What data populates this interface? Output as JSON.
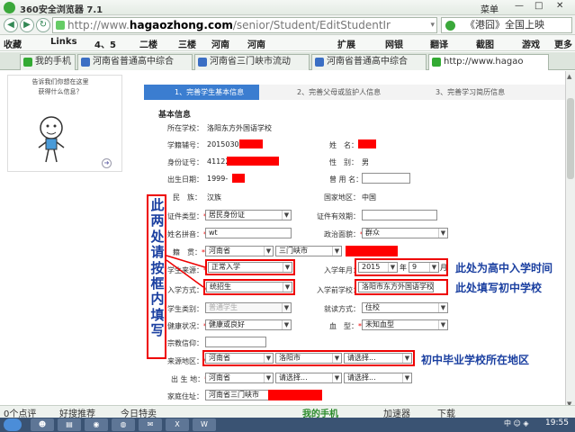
{
  "browser": {
    "title": "360安全浏览器 7.1",
    "menu_label": "菜单",
    "url": {
      "scheme": "http://www.",
      "domain": "hagaozhong.com",
      "path": "/senior/Student/EditStudentIr"
    },
    "search_text": "《港囧》全国上映",
    "favorites": [
      "收藏",
      "Links",
      "4、5",
      "二楼",
      "三楼",
      "河南",
      "河南",
      "扩展",
      "网银",
      "翻译",
      "截图",
      "游戏",
      "更多"
    ],
    "tabs": [
      {
        "label": "我的手机",
        "active": false,
        "color": "#33aa33"
      },
      {
        "label": "河南省普通高中综合",
        "active": false,
        "color": "#3b6fc4"
      },
      {
        "label": "河南省三门峡市流动",
        "active": false,
        "color": "#3b6fc4"
      },
      {
        "label": "河南省普通高中综合",
        "active": false,
        "color": "#3b6fc4"
      },
      {
        "label": "http://www.hagao",
        "active": true,
        "color": "#33aa33"
      }
    ]
  },
  "help": {
    "bubble": "告诉我们你想在这里获得什么信息？"
  },
  "steps": [
    "1、完善学生基本信息",
    "2、完善父母或监护人信息",
    "3、完善学习简历信息"
  ],
  "form": {
    "section_title": "基本信息",
    "school_label": "所在学校：",
    "school_value": "洛阳东方外国语学校",
    "student_no_label": "学籍辅号：",
    "student_no_value": "20150301",
    "name_label": "姓　名：",
    "idno_label": "身份证号：",
    "idno_value": "41122",
    "gender_label": "性　别：",
    "gender_value": "男",
    "birth_label": "出生日期：",
    "birth_value": "1999-",
    "former_name_label": "曾 用 名：",
    "nation_label": "民　族：",
    "nation_value": "汉族",
    "country_label": "国家地区：",
    "country_value": "中国",
    "cert_type_label": "证件类型：",
    "cert_type_value": "居民身份证",
    "cert_valid_label": "证件有效期：",
    "pinyin_label": "姓名拼音：",
    "pinyin_value": "wt",
    "political_label": "政治面貌：",
    "political_value": "群众",
    "native_label": "籍　贯：",
    "native_province": "河南省",
    "native_city": "三门峡市",
    "source_label": "学生来源：",
    "source_value": "正常入学",
    "entry_month_label": "入学年月：",
    "entry_year": "2015",
    "year_unit": "年",
    "entry_month": "9",
    "month_unit": "月",
    "entry_mode_label": "入学方式：",
    "entry_mode_value": "统招生",
    "prior_school_label": "入学前学校：",
    "prior_school_value": "洛阳市东方外国语学校",
    "category_label": "学生类别：",
    "category_value": "普通学生",
    "residence_label": "就读方式：",
    "residence_value": "住校",
    "health_label": "健康状况：",
    "health_value": "健康或良好",
    "blood_label": "血　型：",
    "blood_value": "未知血型",
    "religion_label": "宗教信仰：",
    "origin_label": "来源地区：",
    "origin_province": "河南省",
    "origin_city": "洛阳市",
    "origin_district": "请选择...",
    "birthplace_label": "出 生 地：",
    "birthplace_province": "河南省",
    "birthplace_city": "请选择...",
    "birthplace_district": "请选择...",
    "address_label": "家庭住址：",
    "address_value": "河南省三门峡市"
  },
  "annotations": {
    "vertical": "此两处请按框内填写",
    "entry_time": "此处为高中入学时间",
    "prior_school": "此处填写初中学校",
    "graduation_school": "初中毕业学校所在地区"
  },
  "status": {
    "points": "0个点评",
    "recommend": "好搜推荐",
    "deals": "今日特卖",
    "phone": "我的手机",
    "accelerator": "加速器",
    "download": "下载"
  },
  "taskbar": {
    "time": "19:55",
    "tray": "中 ☺ ◈"
  }
}
